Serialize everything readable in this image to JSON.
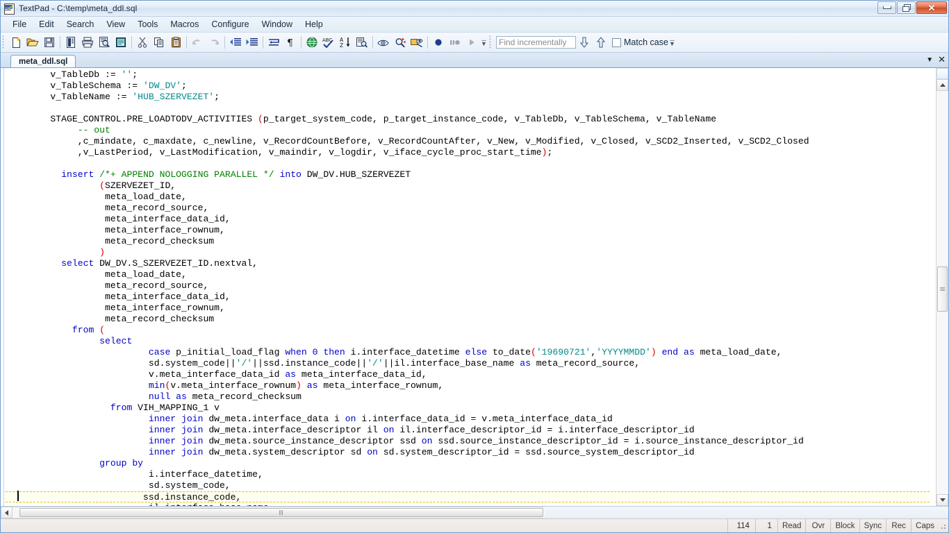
{
  "window": {
    "title": "TextPad - C:\\temp\\meta_ddl.sql",
    "icon": "textpad-icon",
    "buttons": {
      "minimize": "minimize-button",
      "restore": "restore-button",
      "close": "✕"
    }
  },
  "menu": {
    "items": [
      {
        "label": "File"
      },
      {
        "label": "Edit"
      },
      {
        "label": "Search"
      },
      {
        "label": "View"
      },
      {
        "label": "Tools"
      },
      {
        "label": "Macros"
      },
      {
        "label": "Configure"
      },
      {
        "label": "Window"
      },
      {
        "label": "Help"
      }
    ]
  },
  "toolbar": {
    "group1": [
      {
        "name": "new-document-icon",
        "tip": "New"
      },
      {
        "name": "open-folder-icon",
        "tip": "Open"
      },
      {
        "name": "save-disk-icon",
        "tip": "Save"
      }
    ],
    "group2": [
      {
        "name": "file-properties-icon",
        "tip": "Document properties"
      },
      {
        "name": "printer-icon",
        "tip": "Print"
      },
      {
        "name": "print-preview-icon",
        "tip": "Print preview"
      },
      {
        "name": "page-setup-icon",
        "tip": "Page setup"
      }
    ],
    "group3": [
      {
        "name": "cut-scissors-icon",
        "tip": "Cut"
      },
      {
        "name": "copy-icon",
        "tip": "Copy"
      },
      {
        "name": "paste-clipboard-icon",
        "tip": "Paste"
      }
    ],
    "group4": [
      {
        "name": "undo-arrow-icon",
        "tip": "Undo"
      },
      {
        "name": "redo-arrow-icon",
        "tip": "Redo"
      }
    ],
    "group5": [
      {
        "name": "decrease-indent-icon",
        "tip": "Decrease indent"
      },
      {
        "name": "increase-indent-icon",
        "tip": "Increase indent"
      }
    ],
    "group6": [
      {
        "name": "word-wrap-icon",
        "tip": "Word wrap"
      },
      {
        "name": "pilcrow-icon",
        "tip": "Visible spaces"
      }
    ],
    "group7": [
      {
        "name": "globe-internet-icon",
        "tip": "Open from internet"
      },
      {
        "name": "spell-check-icon",
        "tip": "Spelling"
      },
      {
        "name": "sort-az-icon",
        "tip": "Sort"
      },
      {
        "name": "compare-files-icon",
        "tip": "Compare files"
      }
    ],
    "group8": [
      {
        "name": "find-in-files-icon",
        "tip": "Find in files"
      },
      {
        "name": "find-replace-icon",
        "tip": "Replace"
      },
      {
        "name": "bookmark-find-icon",
        "tip": "Find matching"
      }
    ],
    "group9": [
      {
        "name": "record-macro-icon",
        "tip": "Record macro"
      },
      {
        "name": "pause-macro-icon",
        "tip": "Pause recording"
      },
      {
        "name": "play-macro-icon",
        "tip": "Play macro"
      }
    ],
    "overflow_label": "»"
  },
  "search": {
    "placeholder": "Find incrementally",
    "value": "",
    "find_next_icon": "arrow-down-icon",
    "find_prev_icon": "arrow-up-icon",
    "match_case_label": "Match case",
    "match_case_checked": false
  },
  "tabs": {
    "items": [
      {
        "label": "meta_ddl.sql",
        "active": true
      }
    ],
    "list_icon": "▼",
    "close_icon": "✕"
  },
  "statusbar": {
    "line": "114",
    "col": "1",
    "read": "Read",
    "overwrite": "Ovr",
    "block": "Block",
    "sync": "Sync",
    "rec": "Rec",
    "caps": "Caps"
  },
  "editor": {
    "filename": "meta_ddl.sql",
    "caret_line": 113,
    "colors": {
      "keyword": "#0000c8",
      "comment": "#008000",
      "string": "#008a8a",
      "punctuation": "#cc0000",
      "text": "#000000",
      "background": "#ffffff",
      "current_line_bg": "#fffff0",
      "current_line_border": "#d8c400"
    },
    "lines": [
      "    v_TableDb := '';",
      "    v_TableSchema := 'DW_DV';",
      "    v_TableName := 'HUB_SZERVEZET';",
      "",
      "    STAGE_CONTROL.PRE_LOADTODV_ACTIVITIES (p_target_system_code, p_target_instance_code, v_TableDb, v_TableSchema, v_TableName",
      "         -- out",
      "         ,c_mindate, c_maxdate, c_newline, v_RecordCountBefore, v_RecordCountAfter, v_New, v_Modified, v_Closed, v_SCD2_Inserted, v_SCD2_Closed",
      "         ,v_LastPeriod, v_LastModification, v_maindir, v_logdir, v_iface_cycle_proc_start_time);",
      "",
      "      insert /*+ APPEND NOLOGGING PARALLEL */ into DW_DV.HUB_SZERVEZET",
      "             (SZERVEZET_ID,",
      "              meta_load_date,",
      "              meta_record_source,",
      "              meta_interface_data_id,",
      "              meta_interface_rownum,",
      "              meta_record_checksum",
      "             )",
      "      select DW_DV.S_SZERVEZET_ID.nextval,",
      "              meta_load_date,",
      "              meta_record_source,",
      "              meta_interface_data_id,",
      "              meta_interface_rownum,",
      "              meta_record_checksum",
      "        from (",
      "             select",
      "                      case p_initial_load_flag when 0 then i.interface_datetime else to_date('19690721','YYYYMMDD') end as meta_load_date,",
      "                      sd.system_code||'/'||ssd.instance_code||'/'||il.interface_base_name as meta_record_source,",
      "                      v.meta_interface_data_id as meta_interface_data_id,",
      "                      min(v.meta_interface_rownum) as meta_interface_rownum,",
      "                      null as meta_record_checksum",
      "               from VIH_MAPPING_1 v",
      "                      inner join dw_meta.interface_data i on i.interface_data_id = v.meta_interface_data_id",
      "                      inner join dw_meta.interface_descriptor il on il.interface_descriptor_id = i.interface_descriptor_id",
      "                      inner join dw_meta.source_instance_descriptor ssd on ssd.source_instance_descriptor_id = i.source_instance_descriptor_id",
      "                      inner join dw_meta.system_descriptor sd on sd.system_descriptor_id = ssd.source_system_descriptor_id",
      "             group by",
      "                      i.interface_datetime,",
      "                      sd.system_code,",
      "                      ssd.instance_code,",
      "                      il.interface_base_name"
    ]
  }
}
